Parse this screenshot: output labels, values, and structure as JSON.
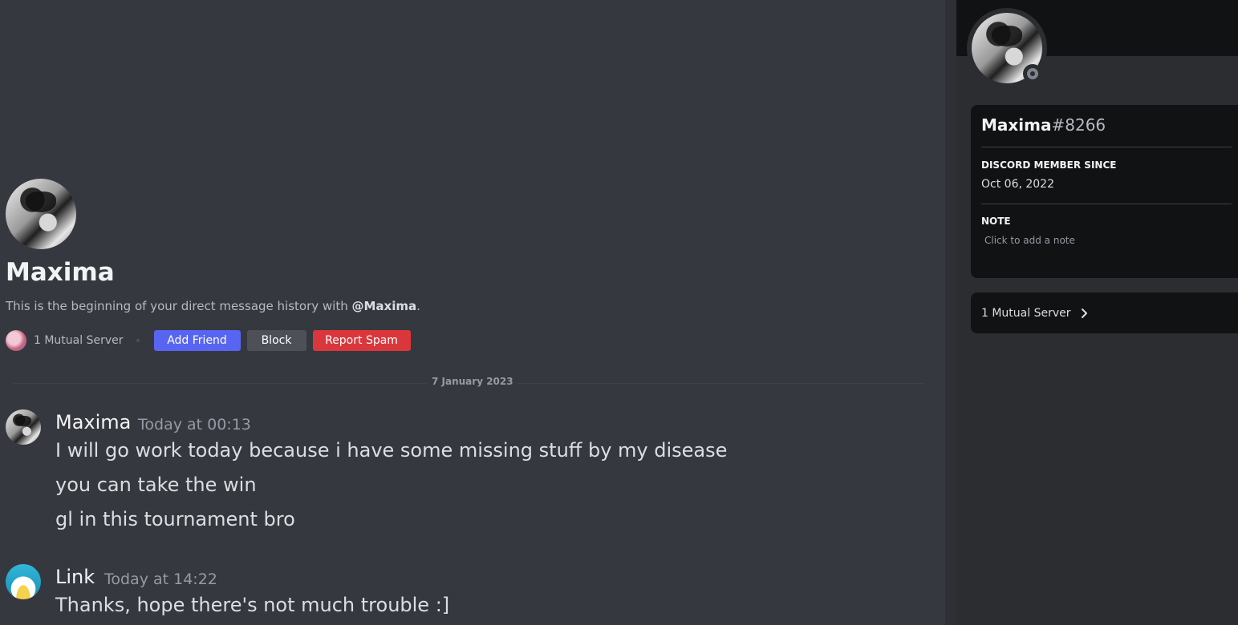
{
  "chat": {
    "intro": {
      "name": "Maxima",
      "text_prefix": "This is the beginning of your direct message history with ",
      "mention": "@Maxima",
      "text_suffix": ".",
      "mutual_server_label": "1 Mutual Server",
      "add_friend_label": "Add Friend",
      "block_label": "Block",
      "report_spam_label": "Report Spam"
    },
    "date_divider": "7 January 2023",
    "messages": [
      {
        "author": "Maxima",
        "time": "Today at 00:13",
        "lines": [
          "I will go work today because i have some missing stuff by my disease",
          "you can take the win",
          "gl in this tournament bro"
        ]
      },
      {
        "author": "Link",
        "time": "Today at 14:22",
        "lines": [
          "Thanks, hope there's not much trouble :]"
        ]
      }
    ]
  },
  "profile": {
    "username": "Maxima",
    "discriminator": "#8266",
    "member_since_heading": "DISCORD MEMBER SINCE",
    "member_since_value": "Oct 06, 2022",
    "note_heading": "NOTE",
    "note_placeholder": "Click to add a note",
    "mutual_servers_label": "1 Mutual Server",
    "status": "offline"
  },
  "colors": {
    "blurple": "#5865f2",
    "danger": "#da373c",
    "secondary": "#4e5058",
    "chat_bg": "#36383f",
    "panel_bg": "#2b2d31",
    "card_bg": "#111214"
  },
  "icons": {
    "chevron": "chevron-right-icon",
    "status": "offline-status-icon"
  }
}
